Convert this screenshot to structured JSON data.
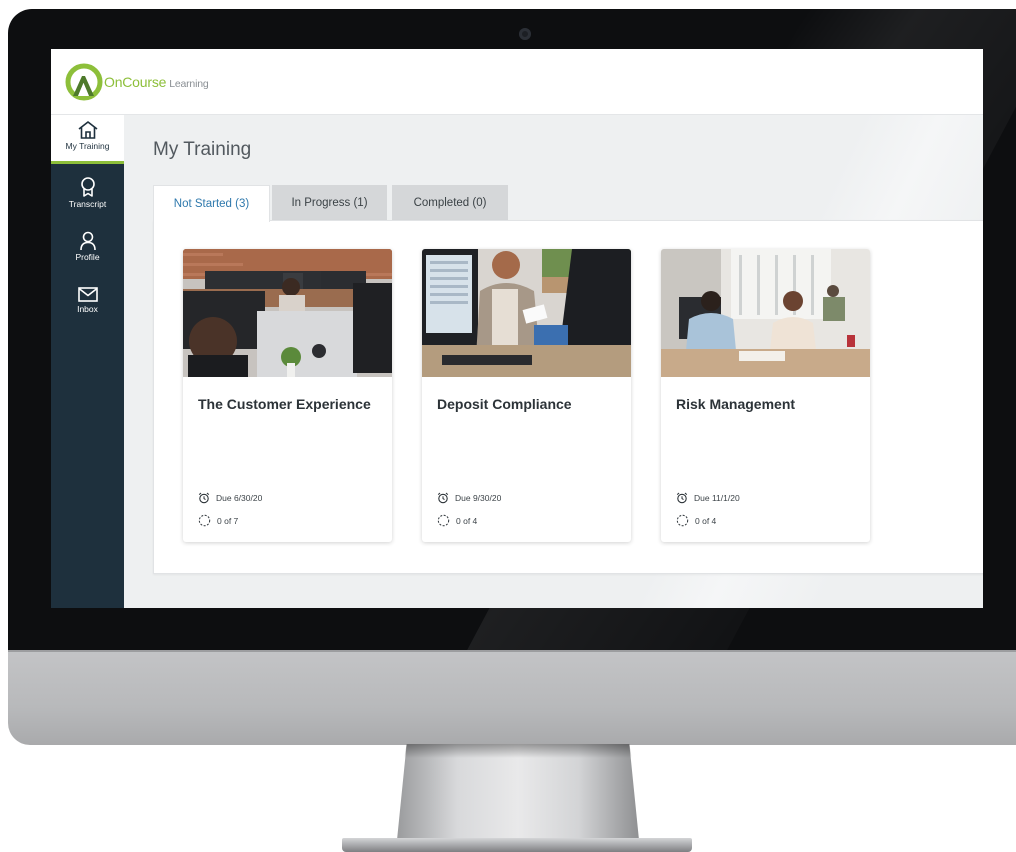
{
  "app": {
    "brand_primary": "OnCourse",
    "brand_secondary": "Learning",
    "accent_color": "#8dbf3a",
    "sidebar_color": "#1e303d",
    "link_color": "#2f79ad"
  },
  "sidebar": {
    "items": [
      {
        "label": "My Training",
        "icon": "home-icon",
        "active": true
      },
      {
        "label": "Transcript",
        "icon": "ribbon-icon",
        "active": false
      },
      {
        "label": "Profile",
        "icon": "user-icon",
        "active": false
      },
      {
        "label": "Inbox",
        "icon": "mail-icon",
        "active": false
      }
    ]
  },
  "main": {
    "title": "My Training",
    "tabs": [
      {
        "label": "Not Started (3)",
        "active": true
      },
      {
        "label": "In Progress (1)",
        "active": false
      },
      {
        "label": "Completed (0)",
        "active": false
      }
    ],
    "courses": [
      {
        "title": "The Customer Experience",
        "due": "Due 6/30/20",
        "progress": "0 of 7",
        "image": "call-center-photo"
      },
      {
        "title": "Deposit Compliance",
        "due": "Due 9/30/20",
        "progress": "0 of 4",
        "image": "bank-teller-photo"
      },
      {
        "title": "Risk Management",
        "due": "Due 11/1/20",
        "progress": "0 of 4",
        "image": "office-meeting-photo"
      }
    ]
  }
}
